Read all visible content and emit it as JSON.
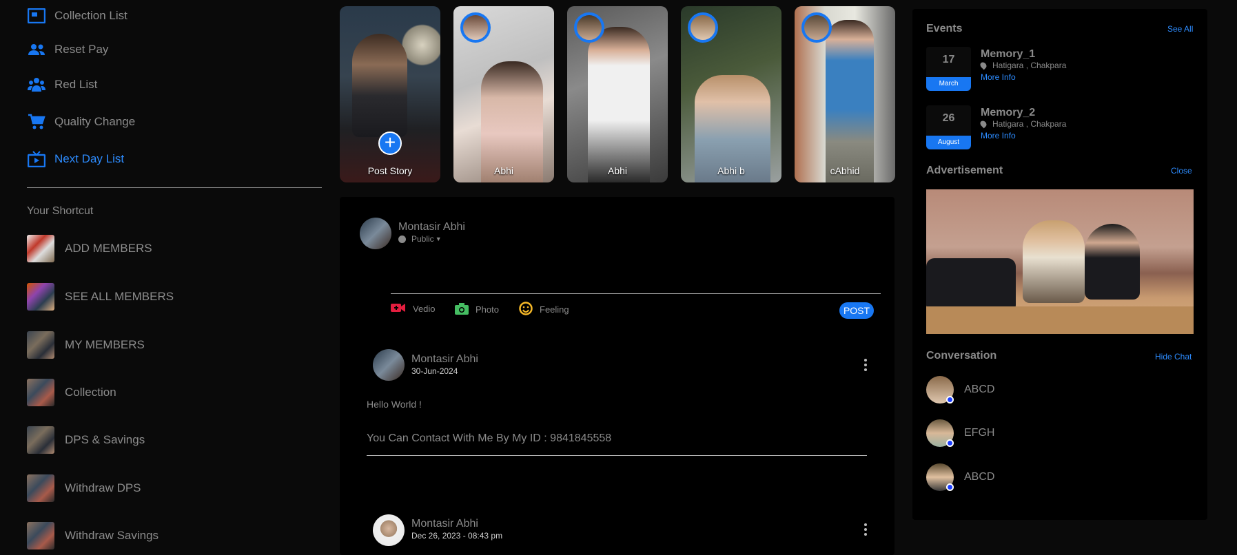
{
  "sidebar": {
    "nav": [
      {
        "label": "Collection List",
        "icon": "collection-icon"
      },
      {
        "label": "Reset Pay",
        "icon": "users-icon"
      },
      {
        "label": "Red List",
        "icon": "group-icon"
      },
      {
        "label": "Quality Change",
        "icon": "cart-icon"
      },
      {
        "label": "Next Day List",
        "icon": "tv-icon",
        "active": true
      }
    ],
    "shortcut_title": "Your Shortcut",
    "shortcuts": [
      "ADD MEMBERS",
      "SEE ALL MEMBERS",
      "MY MEMBERS",
      "Collection",
      "DPS & Savings",
      "Withdraw DPS",
      "Withdraw Savings"
    ]
  },
  "stories": [
    {
      "name": "Post Story"
    },
    {
      "name": "Abhi"
    },
    {
      "name": "Abhi"
    },
    {
      "name": "Abhi b"
    },
    {
      "name": "cAbhid"
    }
  ],
  "composer": {
    "author": "Montasir Abhi",
    "privacy": "Public",
    "actions": [
      {
        "label": "Vedio",
        "color": "#e41e3f"
      },
      {
        "label": "Photo",
        "color": "#45bd62"
      },
      {
        "label": "Feeling",
        "color": "#f7b928"
      }
    ],
    "post_label": "POST"
  },
  "posts": [
    {
      "author": "Montasir Abhi",
      "date": "30-Jun-2024",
      "text1": "Hello World !",
      "text2": "You Can Contact With Me By My ID : 9841845558"
    },
    {
      "author": "Montasir Abhi",
      "date": "Dec 26, 2023 - 08:43 pm"
    }
  ],
  "events": {
    "title": "Events",
    "see_all": "See All",
    "items": [
      {
        "day": "17",
        "month": "March",
        "title": "Memory_1",
        "location": "Hatigara , Chakpara",
        "more": "More Info"
      },
      {
        "day": "26",
        "month": "August",
        "title": "Memory_2",
        "location": "Hatigara , Chakpara",
        "more": "More Info"
      }
    ]
  },
  "advertisement": {
    "title": "Advertisement",
    "close": "Close"
  },
  "conversation": {
    "title": "Conversation",
    "hide": "Hide Chat",
    "items": [
      {
        "name": "ABCD"
      },
      {
        "name": "EFGH"
      },
      {
        "name": "ABCD"
      }
    ]
  },
  "colors": {
    "accent": "#1877f2",
    "online": "#1a3dff"
  }
}
